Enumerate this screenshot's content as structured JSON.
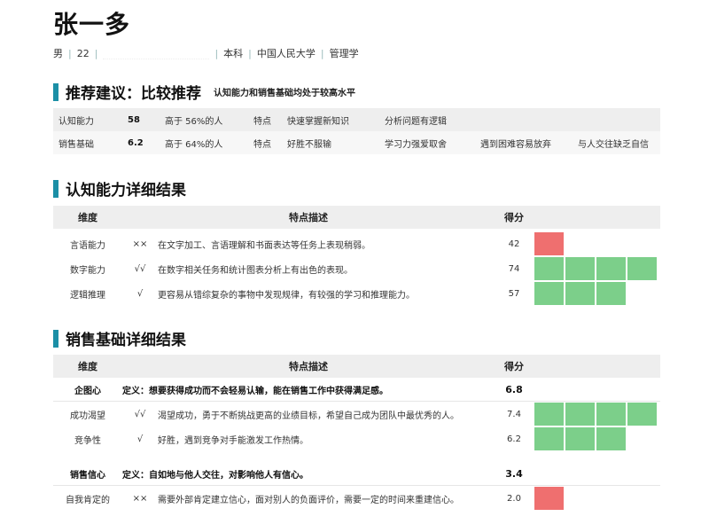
{
  "profile": {
    "name": "张一多",
    "gender": "男",
    "age": "22",
    "education": "本科",
    "school": "中国人民大学",
    "major": "管理学"
  },
  "recommendation": {
    "title": "推荐建议：比较推荐",
    "subtitle": "认知能力和销售基础均处于较高水平",
    "rows": [
      {
        "label": "认知能力",
        "score": "58",
        "percentile": "高于 56%的人",
        "feature_label": "特点",
        "features": [
          "快速掌握新知识",
          "分析问题有逻辑",
          "",
          ""
        ]
      },
      {
        "label": "销售基础",
        "score": "6.2",
        "percentile": "高于 64%的人",
        "feature_label": "特点",
        "features": [
          "好胜不服输",
          "学习力强爱取舍",
          "遇到困难容易放弃",
          "与人交往缺乏自信"
        ]
      }
    ]
  },
  "cognitive": {
    "title": "认知能力详细结果",
    "headers": {
      "dimension": "维度",
      "description": "特点描述",
      "score": "得分"
    },
    "rows": [
      {
        "name": "言语能力",
        "mark": "××",
        "desc": "在文字加工、言语理解和书面表达等任务上表现稍弱。",
        "score": "42",
        "level": 1,
        "color": "red"
      },
      {
        "name": "数字能力",
        "mark": "√√",
        "desc": "在数字相关任务和统计图表分析上有出色的表现。",
        "score": "74",
        "level": 4,
        "color": "green"
      },
      {
        "name": "逻辑推理",
        "mark": "√",
        "desc": "更容易从错综复杂的事物中发现规律，有较强的学习和推理能力。",
        "score": "57",
        "level": 3,
        "color": "green"
      }
    ]
  },
  "sales": {
    "title": "销售基础详细结果",
    "headers": {
      "dimension": "维度",
      "description": "特点描述",
      "score": "得分"
    },
    "groups": [
      {
        "name": "企图心",
        "definition": "定义：想要获得成功而不会轻易认输，能在销售工作中获得满足感。",
        "score": "6.8",
        "rows": [
          {
            "name": "成功渴望",
            "mark": "√√",
            "desc": "渴望成功，勇于不断挑战更高的业绩目标，希望自己成为团队中最优秀的人。",
            "score": "7.4",
            "level": 4,
            "color": "green"
          },
          {
            "name": "竞争性",
            "mark": "√",
            "desc": "好胜，遇到竞争对手能激发工作热情。",
            "score": "6.2",
            "level": 3,
            "color": "green"
          }
        ]
      },
      {
        "name": "销售信心",
        "definition": "定义：自如地与他人交往，对影响他人有信心。",
        "score": "3.4",
        "rows": [
          {
            "name": "自我肯定的",
            "mark": "××",
            "desc": "需要外部肯定建立信心，面对别人的负面评价，需要一定的时间来重建信心。",
            "score": "2.0",
            "level": 1,
            "color": "red"
          }
        ]
      }
    ]
  },
  "colors": {
    "accent": "#1b8fa6",
    "red": "#ef6f6f",
    "green": "#7ccf8a",
    "yellow": "#f5c86a"
  }
}
